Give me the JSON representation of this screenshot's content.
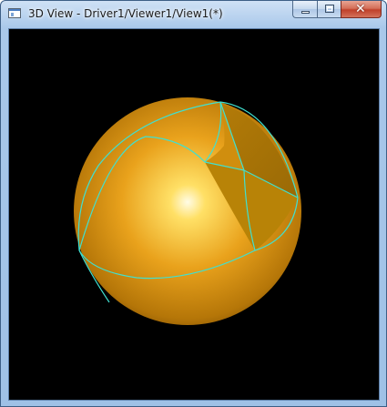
{
  "window": {
    "title": "3D View - Driver1/Viewer1/View1(*)",
    "caption_buttons": {
      "minimize_glyph": "minimize-icon",
      "maximize_glyph": "maximize-icon",
      "close_glyph": "✕"
    }
  },
  "viewport": {
    "background": "#000000",
    "scene": {
      "object": "sphere",
      "shape_color": "#e9a21c",
      "edge_color": "#40e0d0",
      "cut_face_color": "#b8860b"
    }
  }
}
